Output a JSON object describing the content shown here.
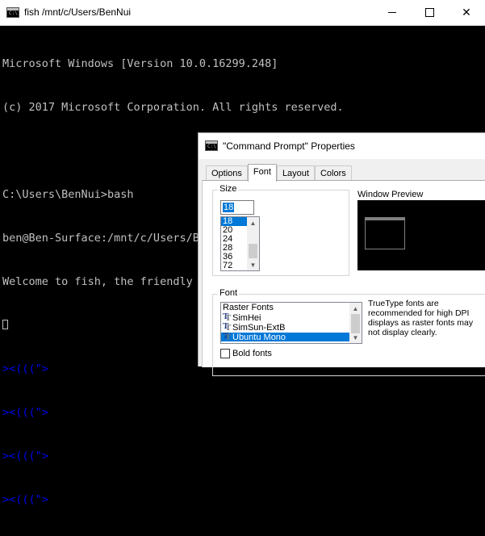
{
  "console": {
    "title": "fish  /mnt/c/Users/BenNui",
    "icon_text": "C:\\",
    "lines": [
      "Microsoft Windows [Version 10.0.16299.248]",
      "(c) 2017 Microsoft Corporation. All rights reserved.",
      "",
      "C:\\Users\\BenNui>bash",
      "ben@Ben-Surface:/mnt/c/Users/BenNui$ fish",
      "Welcome to fish, the friendly interactive shell"
    ],
    "fish_lines": [
      "><(((\">",
      "><(((\">",
      "><(((\">",
      "><(((\">"
    ],
    "colors": {
      "background": "#000000",
      "text": "#c0c0c0",
      "fish": "#0000ee"
    }
  },
  "dialog": {
    "title": "\"Command Prompt\" Properties",
    "icon_text": "C:\\",
    "tabs": [
      {
        "label": "Options",
        "active": false
      },
      {
        "label": "Font",
        "active": true
      },
      {
        "label": "Layout",
        "active": false
      },
      {
        "label": "Colors",
        "active": false
      }
    ],
    "size_group_label": "Size",
    "size_value": "18",
    "sizes": [
      "18",
      "20",
      "24",
      "28",
      "36",
      "72"
    ],
    "selected_size": "18",
    "window_preview_label": "Window Preview",
    "font_group_label": "Font",
    "fonts": [
      {
        "name": "Raster Fonts",
        "truetype": false,
        "selected": false
      },
      {
        "name": "SimHei",
        "truetype": true,
        "selected": false
      },
      {
        "name": "SimSun-ExtB",
        "truetype": true,
        "selected": false
      },
      {
        "name": "Ubuntu Mono",
        "truetype": true,
        "selected": true
      }
    ],
    "note": "TrueType fonts are recommended for high DPI displays as raster fonts may not display clearly.",
    "bold_label": "Bold fonts",
    "bold_checked": false
  }
}
